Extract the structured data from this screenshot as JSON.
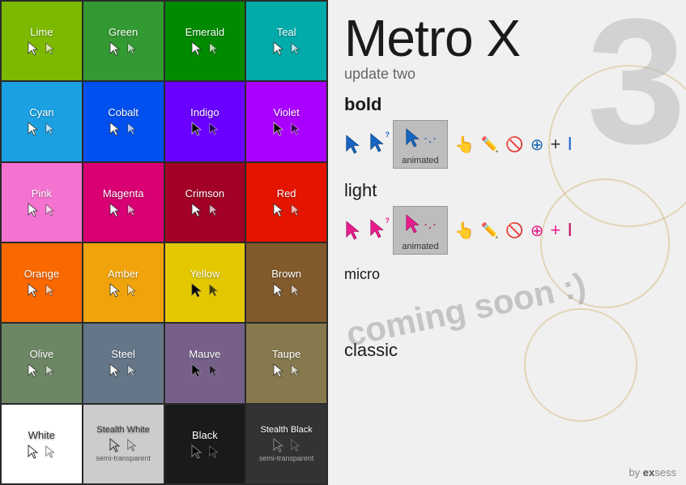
{
  "app": {
    "title": "Metro X",
    "subtitle": "update two",
    "watermark": "3",
    "credit": "by exsess"
  },
  "sections": {
    "bold": "bold",
    "light": "light",
    "micro": "micro",
    "coming_soon": "coming soon :)",
    "classic": "classic"
  },
  "tiles": [
    {
      "id": "lime",
      "label": "Lime",
      "class": "tile-lime"
    },
    {
      "id": "green",
      "label": "Green",
      "class": "tile-green"
    },
    {
      "id": "emerald",
      "label": "Emerald",
      "class": "tile-emerald"
    },
    {
      "id": "teal",
      "label": "Teal",
      "class": "tile-teal"
    },
    {
      "id": "cyan",
      "label": "Cyan",
      "class": "tile-cyan"
    },
    {
      "id": "cobalt",
      "label": "Cobalt",
      "class": "tile-cobalt"
    },
    {
      "id": "indigo",
      "label": "Indigo",
      "class": "tile-indigo"
    },
    {
      "id": "violet",
      "label": "Violet",
      "class": "tile-violet"
    },
    {
      "id": "pink",
      "label": "Pink",
      "class": "tile-pink"
    },
    {
      "id": "magenta",
      "label": "Magenta",
      "class": "tile-magenta"
    },
    {
      "id": "crimson",
      "label": "Crimson",
      "class": "tile-crimson"
    },
    {
      "id": "red",
      "label": "Red",
      "class": "tile-red"
    },
    {
      "id": "orange",
      "label": "Orange",
      "class": "tile-orange"
    },
    {
      "id": "amber",
      "label": "Amber",
      "class": "tile-amber"
    },
    {
      "id": "yellow",
      "label": "Yellow",
      "class": "tile-yellow"
    },
    {
      "id": "brown",
      "label": "Brown",
      "class": "tile-brown"
    },
    {
      "id": "olive",
      "label": "Olive",
      "class": "tile-olive"
    },
    {
      "id": "steel",
      "label": "Steel",
      "class": "tile-steel"
    },
    {
      "id": "mauve",
      "label": "Mauve",
      "class": "tile-mauve"
    },
    {
      "id": "taupe",
      "label": "Taupe",
      "class": "tile-taupe"
    },
    {
      "id": "white",
      "label": "White",
      "class": "tile-white"
    },
    {
      "id": "stealth-white",
      "label": "Stealth White",
      "class": "tile-stealth-white"
    },
    {
      "id": "black",
      "label": "Black",
      "class": "tile-black"
    },
    {
      "id": "stealth-black",
      "label": "Stealth Black",
      "class": "tile-stealth-black"
    }
  ],
  "animated_label": "animated"
}
